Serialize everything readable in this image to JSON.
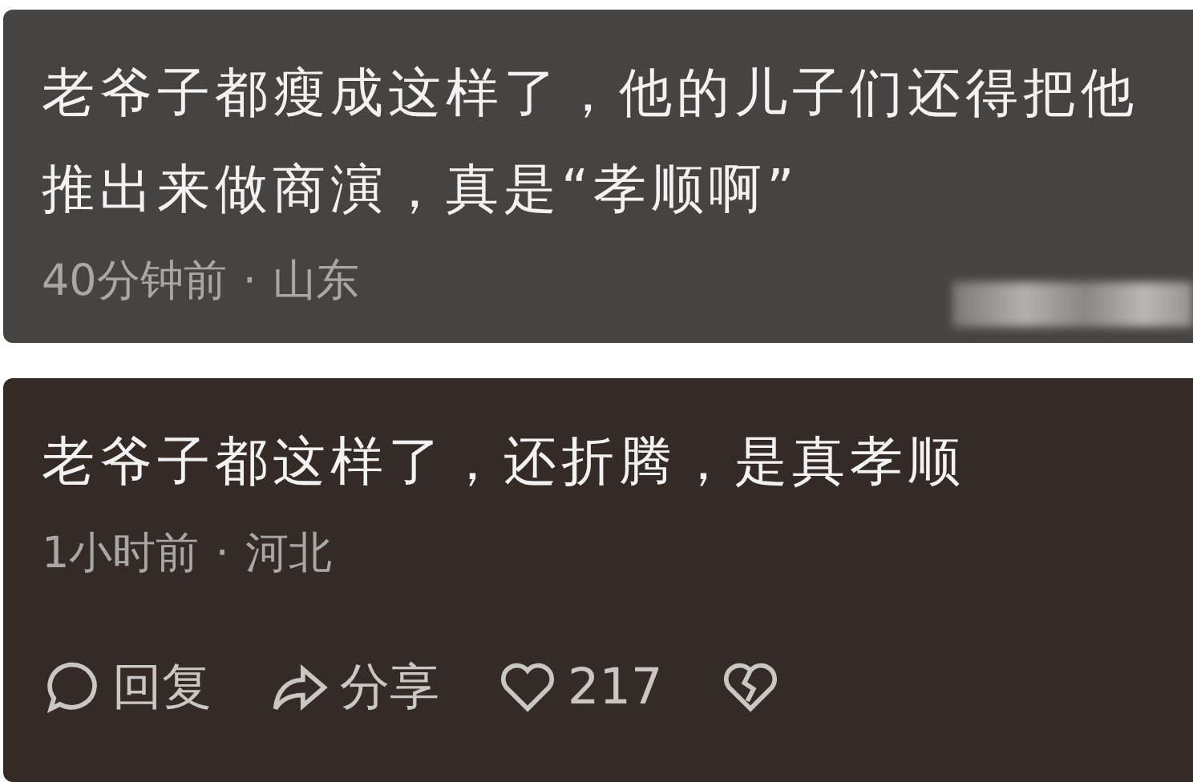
{
  "comments": [
    {
      "lines": [
        "老爷子都瘦成这样了，他的儿子们还得把他",
        "推出来做商演，真是“孝顺啊”"
      ],
      "time": "40分钟前",
      "separator": "·",
      "location": "山东",
      "color": "#464343",
      "blurred": true
    },
    {
      "lines": [
        "老爷子都这样了，还折腾，是真孝顺"
      ],
      "time": "1小时前",
      "separator": "·",
      "location": "河北",
      "color": "#352b26",
      "blurred": false,
      "actions": [
        {
          "kind": "reply",
          "label": "回复"
        },
        {
          "kind": "share",
          "label": "分享"
        },
        {
          "kind": "like",
          "label": "217"
        },
        {
          "kind": "dislike"
        }
      ]
    }
  ]
}
